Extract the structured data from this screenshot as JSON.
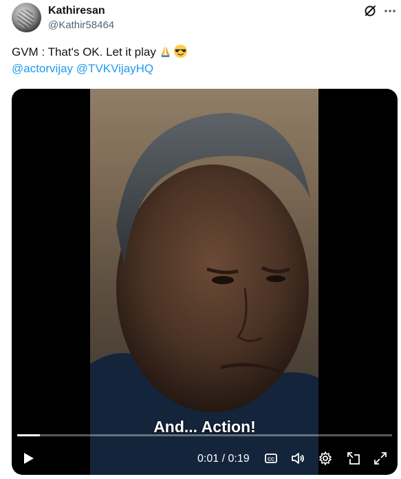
{
  "author": {
    "display_name": "Kathiresan",
    "handle": "@Kathir58464"
  },
  "tweet": {
    "text": "GVM : That's OK. Let it play",
    "emojis": [
      "folded-hands-icon",
      "smiling-face-with-sunglasses-icon"
    ],
    "mentions": [
      "@actorvijay",
      "@TVKVijayHQ"
    ]
  },
  "video": {
    "subtitle": "And... Action!",
    "time_display": "0:01 / 0:19",
    "progress_fraction": 0.06
  },
  "icons": {
    "grok": "grok-icon",
    "more": "more-icon",
    "play": "play-icon",
    "captions": "captions-icon",
    "volume": "volume-icon",
    "settings": "settings-icon",
    "pip": "picture-in-picture-icon",
    "fullscreen": "fullscreen-icon"
  },
  "colors": {
    "link": "#1d9bf0",
    "text": "#0f1419",
    "secondary": "#536471"
  }
}
